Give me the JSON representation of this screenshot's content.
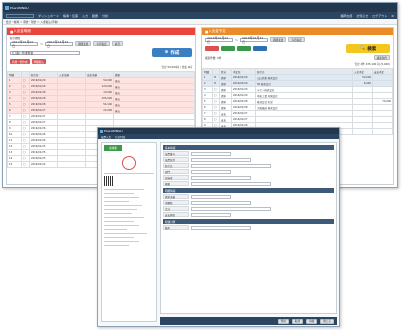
{
  "main_window": {
    "title": "Plus1WINGU",
    "user_name": "福岡太郎",
    "status_links": [
      "お知らせ",
      "ログアウト",
      "設定"
    ],
    "toolbar": [
      "ダッシュボード",
      "帳簿・伝票",
      "入力",
      "経費",
      "分析"
    ],
    "breadcrumb": "会計・帳簿 ＞ 預金・現金 ＞ 入金取込(手動)"
  },
  "left_pane": {
    "header": "入出金明細",
    "period_label": "取引期間",
    "date_from": "2017年01月01日",
    "date_to": "2017年12月31日",
    "btn_change_period": "期間変更",
    "btn_this_month": "今月指定",
    "btn_prev": "前月",
    "account_label": "口座名称",
    "account_value": "[口座] 普通預金",
    "btn_create": "作成",
    "btn_add": "新規一括作成",
    "btn_import": "明細取込",
    "summary": "合計 50,000円 / 支払 0円",
    "columns": [
      "明細",
      "",
      "取引日",
      "入金金額",
      "出金金額",
      "摘要"
    ],
    "rows": [
      [
        "1",
        "□",
        "2016/01/29",
        "",
        "50,000",
        "振込"
      ],
      [
        "2",
        "□",
        "2016/01/29",
        "",
        "120,000",
        "振込"
      ],
      [
        "3",
        "□",
        "2016/01/28",
        "",
        "13,000",
        "振込"
      ],
      [
        "4",
        "□",
        "2016/01/28",
        "",
        "105,000",
        "振込"
      ],
      [
        "5",
        "□",
        "2016/01/28",
        "",
        "54,100",
        "振込"
      ],
      [
        "6",
        "□",
        "2016/01/27",
        "",
        "22,000",
        "振込"
      ],
      [
        "7",
        "□",
        "2016/01/27",
        "",
        "",
        ""
      ],
      [
        "8",
        "□",
        "2016/01/27",
        "",
        "",
        ""
      ],
      [
        "9",
        "□",
        "2016/01/26",
        "",
        "",
        ""
      ],
      [
        "10",
        "□",
        "2016/01/26",
        "",
        "",
        ""
      ],
      [
        "11",
        "□",
        "2016/01/26",
        "",
        "",
        ""
      ],
      [
        "12",
        "□",
        "2016/01/25",
        "",
        "",
        ""
      ],
      [
        "13",
        "□",
        "2016/01/25",
        "",
        "",
        ""
      ],
      [
        "14",
        "□",
        "2016/01/25",
        "",
        "",
        ""
      ],
      [
        "15",
        "□",
        "2016/01/24",
        "",
        "",
        ""
      ]
    ]
  },
  "right_pane": {
    "header": "入出金予定",
    "date_from": "2016年01月01日",
    "date_to": "2016年01月31日",
    "btn_change_period": "期間変更",
    "btn_this_month": "今月指定",
    "btn_search": "検索",
    "btn_reset": "検索条件",
    "search_label": "検索条件",
    "search_count": "検索件数: 6件",
    "summary": "合計 2件 235,100 円 (5,000)",
    "columns": [
      "明細",
      "",
      "区分",
      "予定日",
      "取引先",
      "入金予定",
      "支払予定"
    ],
    "rows": [
      [
        "1",
        "☑",
        "請求",
        "2016/01/29",
        "山口商事 株式会社",
        "50,000",
        ""
      ],
      [
        "2",
        "☑",
        "請求",
        "2016/01/29",
        "SP 株式会社",
        "6,000",
        ""
      ],
      [
        "3",
        "□",
        "請求",
        "2016/01/29",
        "テクノ株式会社",
        "",
        ""
      ],
      [
        "4",
        "□",
        "請求",
        "2016/01/29",
        "中央工業 有限会社",
        "",
        ""
      ],
      [
        "5",
        "□",
        "請求",
        "2016/01/28",
        "株式会社 丸栄",
        "",
        "70,000"
      ],
      [
        "6",
        "□",
        "請求",
        "2016/01/28",
        "大阪運送 株式会社",
        "",
        ""
      ],
      [
        "7",
        "□",
        "支払",
        "2016/01/27",
        "",
        "",
        ""
      ],
      [
        "8",
        "□",
        "支払",
        "2016/01/27",
        "",
        "",
        ""
      ],
      [
        "9",
        "□",
        "支払",
        "2016/01/26",
        "",
        "",
        ""
      ],
      [
        "10",
        "□",
        "支払",
        "2016/01/26",
        "",
        "",
        ""
      ]
    ]
  },
  "front_window": {
    "title": "Plus1WINGU",
    "tabs": [
      "伝票入力",
      "仕訳明細"
    ],
    "stamp_label": "請求書",
    "form_labels": [
      "伝票番号",
      "伝票日付",
      "取引先",
      "部門",
      "担当者",
      "摘要",
      "請求金額",
      "消費税",
      "合計",
      "支払期日",
      "備考"
    ],
    "sections": [
      "基本情報",
      "明細情報",
      "税額計算"
    ],
    "footer_buttons": [
      "登録",
      "取消",
      "印刷",
      "閉じる"
    ]
  }
}
